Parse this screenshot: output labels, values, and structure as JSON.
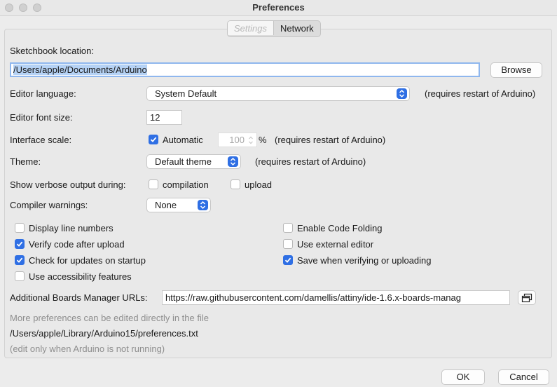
{
  "window": {
    "title": "Preferences"
  },
  "tabs": [
    {
      "label": "Settings",
      "active": true
    },
    {
      "label": "Network",
      "active": false
    }
  ],
  "sketchbook": {
    "label": "Sketchbook location:",
    "value": "/Users/apple/Documents/Arduino",
    "browse_label": "Browse"
  },
  "editor_language": {
    "label": "Editor language:",
    "value": "System Default",
    "note": "(requires restart of Arduino)"
  },
  "editor_font_size": {
    "label": "Editor font size:",
    "value": "12"
  },
  "interface_scale": {
    "label": "Interface scale:",
    "automatic_label": "Automatic",
    "automatic_checked": true,
    "value": "100",
    "unit": "%",
    "note": "(requires restart of Arduino)"
  },
  "theme": {
    "label": "Theme:",
    "value": "Default theme",
    "note": "(requires restart of Arduino)"
  },
  "verbose": {
    "label": "Show verbose output during:",
    "compilation_label": "compilation",
    "compilation_checked": false,
    "upload_label": "upload",
    "upload_checked": false
  },
  "compiler_warnings": {
    "label": "Compiler warnings:",
    "value": "None"
  },
  "options": {
    "display_line_numbers": {
      "label": "Display line numbers",
      "checked": false
    },
    "verify_after_upload": {
      "label": "Verify code after upload",
      "checked": true
    },
    "check_updates": {
      "label": "Check for updates on startup",
      "checked": true
    },
    "accessibility": {
      "label": "Use accessibility features",
      "checked": false
    },
    "code_folding": {
      "label": "Enable Code Folding",
      "checked": false
    },
    "external_editor": {
      "label": "Use external editor",
      "checked": false
    },
    "save_when_verifying": {
      "label": "Save when verifying or uploading",
      "checked": true
    }
  },
  "boards_manager": {
    "label": "Additional Boards Manager URLs:",
    "value": "https://raw.githubusercontent.com/damellis/attiny/ide-1.6.x-boards-manag"
  },
  "footer": {
    "more_prefs": "More preferences can be edited directly in the file",
    "prefs_path": "/Users/apple/Library/Arduino15/preferences.txt",
    "edit_note": "(edit only when Arduino is not running)"
  },
  "buttons": {
    "ok": "OK",
    "cancel": "Cancel"
  },
  "colors": {
    "accent": "#2f6fe4",
    "focus_ring": "#8fb7ee",
    "selection": "#b5d2f5"
  }
}
